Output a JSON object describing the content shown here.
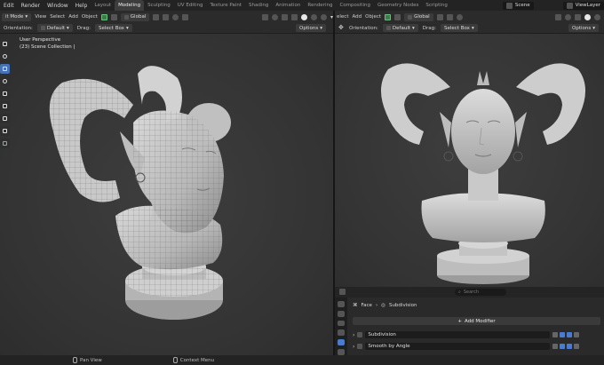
{
  "topbar": {
    "menus": [
      "Edit",
      "Render",
      "Window",
      "Help"
    ],
    "workspaces": [
      "Layout",
      "Modeling",
      "Sculpting",
      "UV Editing",
      "Texture Paint",
      "Shading",
      "Animation",
      "Rendering",
      "Compositing",
      "Geometry Nodes",
      "Scripting"
    ],
    "active_workspace": "Modeling",
    "scene": "Scene",
    "view_layer": "ViewLayer"
  },
  "left_viewport": {
    "mode": "it Mode",
    "menus": [
      "View",
      "Select",
      "Add",
      "Object"
    ],
    "transform": "Global",
    "options": "Options",
    "orientation_label": "Orientation:",
    "orientation_value": "Default",
    "drag_label": "Drag:",
    "drag_value": "Select Box",
    "view_name": "User Perspective",
    "collection": "(23) Scene Collection | "
  },
  "right_viewport": {
    "mode_tail": "elect",
    "menus": [
      "Add",
      "Object"
    ],
    "transform": "Global",
    "options": "Options",
    "orientation_label": "Orientation:",
    "orientation_value": "Default",
    "drag_label": "Drag:",
    "drag_value": "Select Box"
  },
  "properties": {
    "search_placeholder": "Search",
    "breadcrumb_object": "Face",
    "breadcrumb_modifier": "Subdivision",
    "add_modifier": "Add Modifier",
    "modifiers": [
      "Subdivision",
      "Smooth by Angle"
    ]
  },
  "statusbar": {
    "pan_view": "Pan View",
    "context_menu": "Context Menu"
  },
  "colors": {
    "accent": "#4772b3",
    "mesh": "#c8c8c8",
    "background": "#1d1d1d"
  }
}
